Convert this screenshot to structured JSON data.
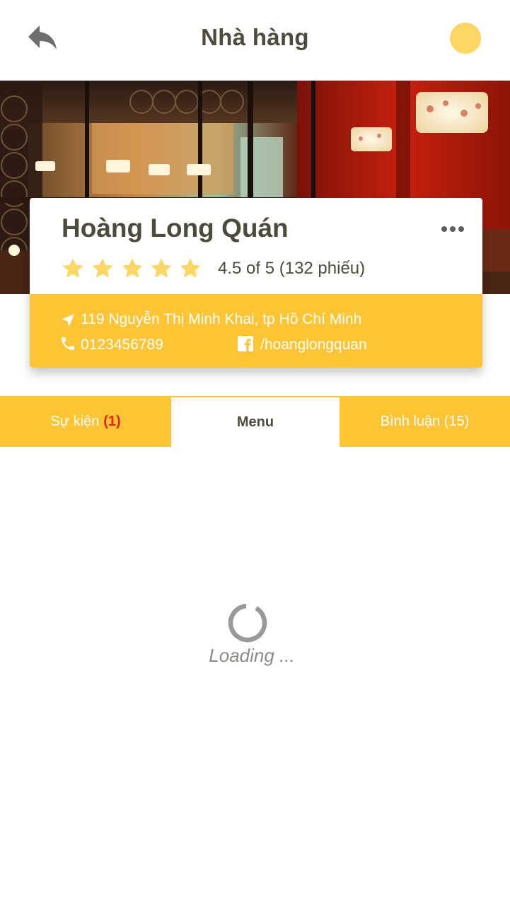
{
  "header": {
    "title": "Nhà hàng",
    "back_icon": "reply-arrow-icon",
    "avatar_color": "#fdd663"
  },
  "restaurant": {
    "name": "Hoàng Long Quán",
    "rating": 4.5,
    "rating_max": 5,
    "stars_shown": 5,
    "rating_text": "4.5 of 5 (132 phiếu)",
    "address": "119 Nguyễn Thị Minh Khai, tp Hồ Chí Minh",
    "phone": "0123456789",
    "facebook": "/hoanglongquan",
    "more_icon": "more-horizontal-icon"
  },
  "tabs": [
    {
      "label": "Sự kiện",
      "count": "(1)"
    },
    {
      "label": "Menu",
      "active": true
    },
    {
      "label": "Bình luận (15)"
    }
  ],
  "status": {
    "loading_text": "Loading ..."
  },
  "colors": {
    "accent": "#ffc534",
    "star": "#fdd663",
    "title_text": "#4d4b3c",
    "badge_red": "#e8200f"
  }
}
